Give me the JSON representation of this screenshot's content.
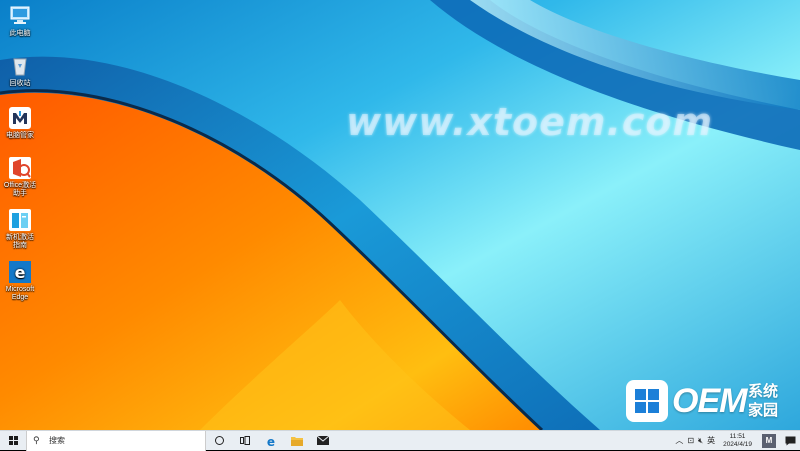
{
  "wallpaper": {
    "watermark": "www.xtoem.com",
    "colors": {
      "blue": "#1fa7e0",
      "cyan": "#7fe8f6",
      "orange": "#ff7a00",
      "yellow": "#ffb400"
    }
  },
  "desktop_icons": [
    {
      "label": "此电脑",
      "icon": "computer-icon"
    },
    {
      "label": "回收站",
      "icon": "recycle-bin-icon"
    },
    {
      "label": "电脑管家",
      "icon": "pc-manager-icon"
    },
    {
      "label": "Office激活\n助手",
      "icon": "office-activator-icon"
    },
    {
      "label": "新机激活\n指南",
      "icon": "guide-book-icon"
    },
    {
      "label": "Microsoft\nEdge",
      "icon": "edge-icon"
    }
  ],
  "oem_logo": {
    "text": "OEM",
    "cn": "系统家园"
  },
  "taskbar": {
    "search_placeholder": "搜索",
    "tray": {
      "ime": "英",
      "time": "11:51",
      "date": "2024/4/19"
    }
  }
}
